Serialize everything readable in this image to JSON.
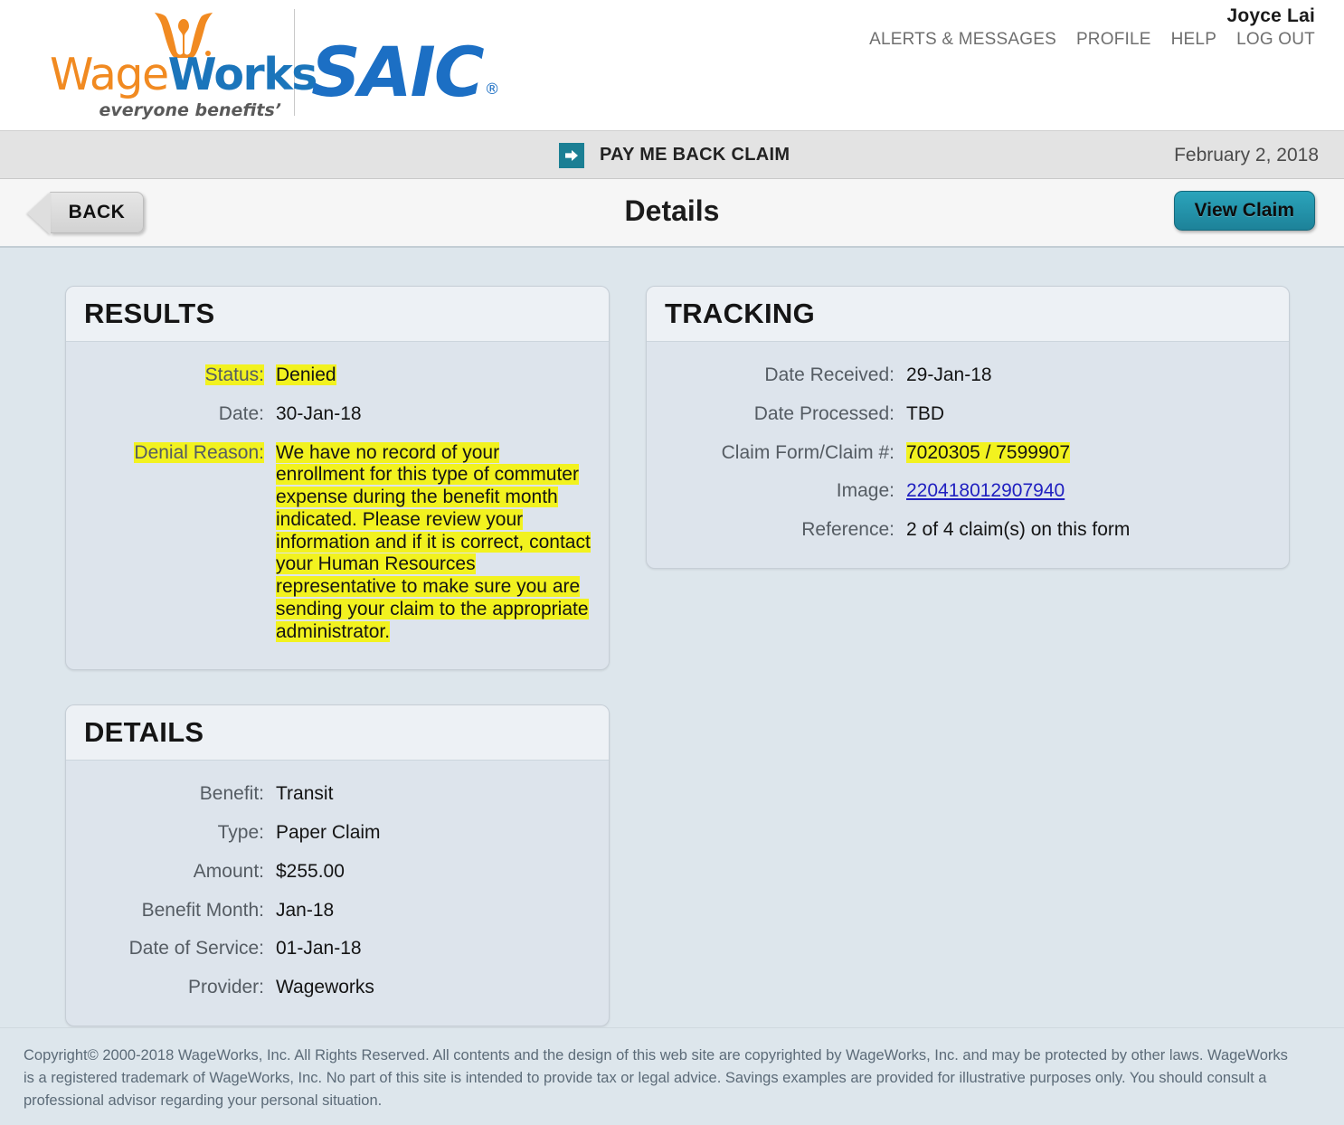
{
  "header": {
    "brand_primary": "WageWorks",
    "brand_primary_part1": "Wage",
    "brand_primary_part2": "Works",
    "brand_tagline": "everyone benefitsʼ",
    "brand_secondary": "SAIC",
    "brand_secondary_mark": "®",
    "user_name": "Joyce Lai",
    "nav": [
      {
        "label": "ALERTS & MESSAGES"
      },
      {
        "label": "PROFILE"
      },
      {
        "label": "HELP"
      },
      {
        "label": "LOG OUT"
      }
    ]
  },
  "claim_bar": {
    "icon": "arrow-right-icon",
    "title": "PAY ME BACK CLAIM",
    "date": "February 2, 2018"
  },
  "toolbar": {
    "back_label": "BACK",
    "page_title": "Details",
    "view_claim_label": "View Claim"
  },
  "results": {
    "heading": "RESULTS",
    "status_label": "Status:",
    "status_value": "Denied",
    "date_label": "Date:",
    "date_value": "30-Jan-18",
    "denial_label": "Denial Reason:",
    "denial_value": "We have no record of your enrollment for this type of commuter expense during the benefit month indicated. Please review your information and if it is correct, contact your Human Resources representative to make sure you are sending your claim to the appropriate administrator."
  },
  "details": {
    "heading": "DETAILS",
    "rows": [
      {
        "label": "Benefit:",
        "value": "Transit"
      },
      {
        "label": "Type:",
        "value": "Paper Claim"
      },
      {
        "label": "Amount:",
        "value": "$255.00"
      },
      {
        "label": "Benefit Month:",
        "value": "Jan-18"
      },
      {
        "label": "Date of Service:",
        "value": "01-Jan-18"
      },
      {
        "label": "Provider:",
        "value": "Wageworks"
      }
    ]
  },
  "tracking": {
    "heading": "TRACKING",
    "date_received_label": "Date Received:",
    "date_received_value": "29-Jan-18",
    "date_processed_label": "Date Processed:",
    "date_processed_value": "TBD",
    "claim_form_label": "Claim Form/Claim #:",
    "claim_form_value": "7020305 / 7599907",
    "image_label": "Image:",
    "image_value": "220418012907940",
    "reference_label": "Reference:",
    "reference_value": "2 of 4 claim(s) on this form"
  },
  "footer": {
    "text": "Copyright© 2000-2018 WageWorks, Inc. All Rights Reserved. All contents and the design of this web site are copyrighted by WageWorks, Inc. and may be protected by other laws. WageWorks is a registered trademark of WageWorks, Inc. No part of this site is intended to provide tax or legal advice. Savings examples are provided for illustrative purposes only. You should consult a professional advisor regarding your personal situation."
  },
  "colors": {
    "brand_orange": "#f18a21",
    "brand_blue": "#1b75bb",
    "saic_blue": "#1c6fc4",
    "teal": "#1b7f94",
    "highlight_yellow": "#f2f21f",
    "link_blue": "#2020c0",
    "page_bg": "#dde6ec"
  }
}
